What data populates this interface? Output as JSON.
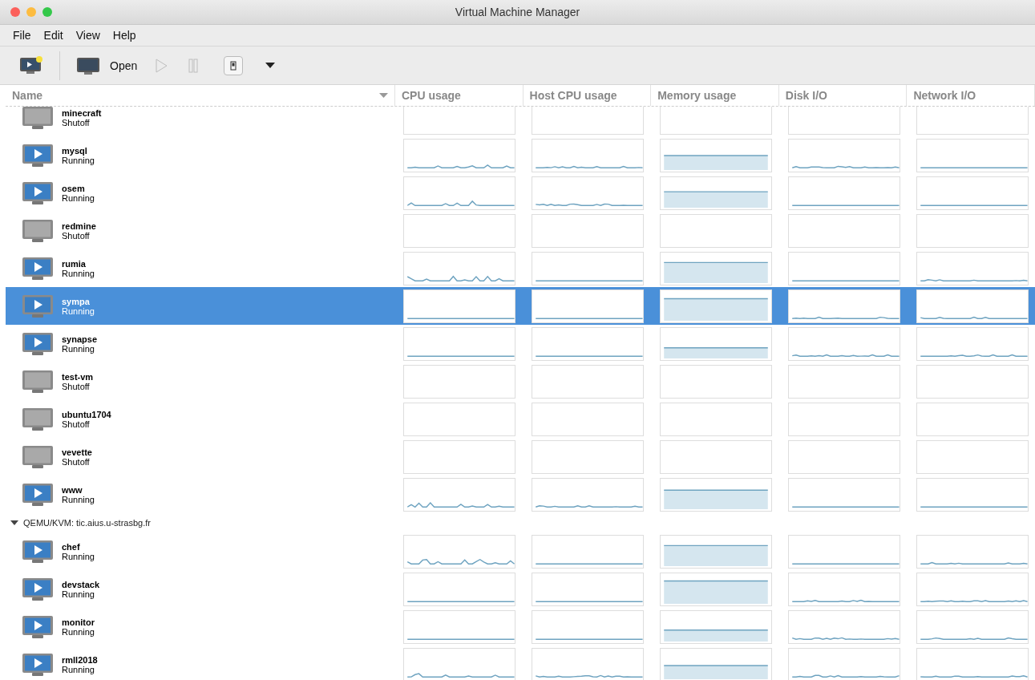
{
  "window": {
    "title": "Virtual Machine Manager"
  },
  "menu": [
    "File",
    "Edit",
    "View",
    "Help"
  ],
  "toolbar": [
    {
      "kind": "new",
      "disabled": false
    },
    {
      "kind": "open",
      "label": "Open",
      "disabled": false
    },
    {
      "kind": "run",
      "disabled": true
    },
    {
      "kind": "pause",
      "disabled": true
    },
    {
      "kind": "shutdown",
      "disabled": false
    },
    {
      "kind": "menu",
      "disabled": false
    }
  ],
  "columns": [
    "Name",
    "CPU usage",
    "Host CPU usage",
    "Memory usage",
    "Disk I/O",
    "Network I/O"
  ],
  "groups": [
    {
      "vms": [
        {
          "name": "minecraft",
          "status": "Shutoff",
          "running": false,
          "selected": false
        },
        {
          "name": "mysql",
          "status": "Running",
          "running": true,
          "selected": false
        },
        {
          "name": "osem",
          "status": "Running",
          "running": true,
          "selected": false
        },
        {
          "name": "redmine",
          "status": "Shutoff",
          "running": false,
          "selected": false
        },
        {
          "name": "rumia",
          "status": "Running",
          "running": true,
          "selected": false
        },
        {
          "name": "sympa",
          "status": "Running",
          "running": true,
          "selected": true
        },
        {
          "name": "synapse",
          "status": "Running",
          "running": true,
          "selected": false
        },
        {
          "name": "test-vm",
          "status": "Shutoff",
          "running": false,
          "selected": false
        },
        {
          "name": "ubuntu1704",
          "status": "Shutoff",
          "running": false,
          "selected": false
        },
        {
          "name": "vevette",
          "status": "Shutoff",
          "running": false,
          "selected": false
        },
        {
          "name": "www",
          "status": "Running",
          "running": true,
          "selected": false
        }
      ]
    },
    {
      "label": "QEMU/KVM: tic.aius.u-strasbg.fr",
      "expanded": true,
      "vms": [
        {
          "name": "chef",
          "status": "Running",
          "running": true,
          "selected": false
        },
        {
          "name": "devstack",
          "status": "Running",
          "running": true,
          "selected": false
        },
        {
          "name": "monitor",
          "status": "Running",
          "running": true,
          "selected": false
        },
        {
          "name": "rmll2018",
          "status": "Running",
          "running": true,
          "selected": false
        }
      ]
    }
  ]
}
